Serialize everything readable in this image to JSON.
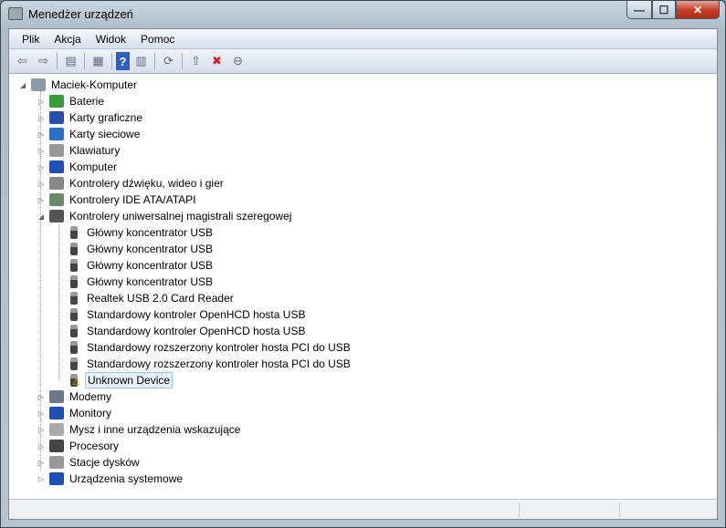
{
  "window": {
    "title": "Menedżer urządzeń",
    "minimize": "—",
    "maximize": "☐",
    "close": "✕"
  },
  "menu": [
    "Plik",
    "Akcja",
    "Widok",
    "Pomoc"
  ],
  "toolbar": [
    {
      "name": "back-icon",
      "glyph": "⇦"
    },
    {
      "name": "forward-icon",
      "glyph": "⇨"
    },
    {
      "sep": true
    },
    {
      "name": "show-hide-console-tree-icon",
      "glyph": "▤"
    },
    {
      "sep": true
    },
    {
      "name": "properties-icon",
      "glyph": "▦"
    },
    {
      "sep": true
    },
    {
      "name": "help-icon",
      "glyph": "?"
    },
    {
      "name": "show-action-pane-icon",
      "glyph": "▥"
    },
    {
      "sep": true
    },
    {
      "name": "scan-hardware-icon",
      "glyph": "⟳"
    },
    {
      "sep": true
    },
    {
      "name": "update-driver-icon",
      "glyph": "⇧"
    },
    {
      "name": "uninstall-icon",
      "glyph": "✖"
    },
    {
      "name": "disable-icon",
      "glyph": "⊖"
    }
  ],
  "tree": {
    "root": "Maciek-Komputer",
    "items": [
      {
        "label": "Baterie",
        "icon": "battery-icon",
        "color": "#3a9a3a"
      },
      {
        "label": "Karty graficzne",
        "icon": "display-adapter-icon",
        "color": "#2b4fa8"
      },
      {
        "label": "Karty sieciowe",
        "icon": "network-adapter-icon",
        "color": "#2b6fc8"
      },
      {
        "label": "Klawiatury",
        "icon": "keyboard-icon",
        "color": "#999999"
      },
      {
        "label": "Komputer",
        "icon": "computer-icon",
        "color": "#1f4fb0"
      },
      {
        "label": "Kontrolery dźwięku, wideo i gier",
        "icon": "speaker-icon",
        "color": "#888888"
      },
      {
        "label": "Kontrolery IDE ATA/ATAPI",
        "icon": "ide-controller-icon",
        "color": "#6a8a6a"
      },
      {
        "label": "Kontrolery uniwersalnej magistrali szeregowej",
        "icon": "usb-icon",
        "color": "#555555",
        "expanded": true,
        "children": [
          {
            "label": "Główny koncentrator USB"
          },
          {
            "label": "Główny koncentrator USB"
          },
          {
            "label": "Główny koncentrator USB"
          },
          {
            "label": "Główny koncentrator USB"
          },
          {
            "label": "Realtek USB 2.0 Card Reader"
          },
          {
            "label": "Standardowy kontroler OpenHCD hosta USB"
          },
          {
            "label": "Standardowy kontroler OpenHCD hosta USB"
          },
          {
            "label": "Standardowy rozszerzony kontroler hosta PCI do USB"
          },
          {
            "label": "Standardowy rozszerzony kontroler hosta PCI do USB"
          },
          {
            "label": "Unknown Device",
            "warning": true,
            "selected": true
          }
        ]
      },
      {
        "label": "Modemy",
        "icon": "modem-icon",
        "color": "#6a7a8a"
      },
      {
        "label": "Monitory",
        "icon": "monitor-icon",
        "color": "#1f4fb0"
      },
      {
        "label": "Mysz i inne urządzenia wskazujące",
        "icon": "mouse-icon",
        "color": "#aaaaaa"
      },
      {
        "label": "Procesory",
        "icon": "processor-icon",
        "color": "#444444"
      },
      {
        "label": "Stacje dysków",
        "icon": "disk-drive-icon",
        "color": "#999999"
      },
      {
        "label": "Urządzenia systemowe",
        "icon": "system-devices-icon",
        "color": "#1f4fb0"
      }
    ]
  },
  "colors": {
    "selection_bg": "#e8f2fc",
    "selection_border": "#99c6ee",
    "warning": "#f2c200"
  }
}
